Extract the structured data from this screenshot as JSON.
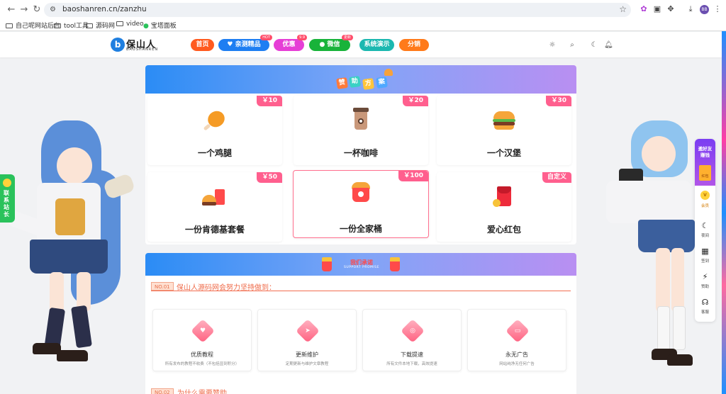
{
  "browser": {
    "url": "baoshanren.cn/zanzhu",
    "profile_initials": "BB",
    "bookmarks": [
      "自己呢网站后台",
      "tool工具",
      "源码网",
      "video",
      "宝塔面板"
    ]
  },
  "site": {
    "logo_text": "保山人",
    "logo_sub": "BAOSHANREN",
    "nav": [
      {
        "label": "首页",
        "color": "#ff5a1f",
        "tag": ""
      },
      {
        "label": "亲测精品",
        "color": "#1e7ef2",
        "tag": "HOT"
      },
      {
        "label": "优惠",
        "color": "#e63fd6",
        "tag": "9.9"
      },
      {
        "label": "微信",
        "color": "#18b33a",
        "tag": "更新"
      },
      {
        "label": "系统演示",
        "color": "#1cb8b0",
        "tag": ""
      },
      {
        "label": "分销",
        "color": "#ff7a1a",
        "tag": ""
      }
    ]
  },
  "sponsor": {
    "banner_chars": [
      "赞",
      "助",
      "方",
      "案"
    ],
    "tiers": [
      {
        "price": "￥10",
        "title": "一个鸡腿",
        "icon": "drumstick-icon"
      },
      {
        "price": "￥20",
        "title": "一杯咖啡",
        "icon": "coffee-icon"
      },
      {
        "price": "￥30",
        "title": "一个汉堡",
        "icon": "burger-icon"
      },
      {
        "price": "￥50",
        "title": "一份肯德基套餐",
        "icon": "kfc-meal-icon"
      },
      {
        "price": "￥100",
        "title": "一份全家桶",
        "icon": "family-bucket-icon"
      },
      {
        "price": "自定义",
        "title": "爱心红包",
        "icon": "red-envelope-icon"
      }
    ]
  },
  "commitment": {
    "banner_title": "我们承诺",
    "banner_sub": "SUPPORT PROMISE",
    "no_tag": "NO.01",
    "heading": "保山人源码网会努力坚持做到：",
    "features": [
      {
        "title": "优质教程",
        "desc": "所有发布的教程不收费（不包括显到积分）",
        "icon": "heart-icon"
      },
      {
        "title": "更新维护",
        "desc": "定期更新与维护文章教程",
        "icon": "cursor-icon"
      },
      {
        "title": "下载提速",
        "desc": "所有文件本地下载，高效提速",
        "icon": "signal-icon"
      },
      {
        "title": "永无广告",
        "desc": "网站纯净无任何广告",
        "icon": "no-ad-icon"
      }
    ],
    "next_tag": "NO.02",
    "next_heading": "为什么需要赞助"
  },
  "contact_tab": "联系站长",
  "toolbar": {
    "invite": "邀好友赚钱",
    "invite_card": "红包",
    "items": [
      {
        "label": "会员",
        "icon": "vip-icon"
      },
      {
        "label": "夜间",
        "icon": "moon-icon"
      },
      {
        "label": "签到",
        "icon": "calendar-icon"
      },
      {
        "label": "赞助",
        "icon": "bolt-icon"
      },
      {
        "label": "客服",
        "icon": "headset-icon"
      }
    ]
  }
}
